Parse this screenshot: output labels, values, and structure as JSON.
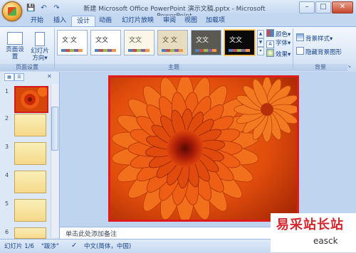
{
  "window": {
    "title": "新建 Microsoft Office PowerPoint 演示文稿.pptx - Microsoft PowerPoint",
    "minimize": "–",
    "maximize": "□",
    "close": "✕"
  },
  "quick_access": {
    "save": "💾",
    "undo": "↶",
    "redo": "↷"
  },
  "tabs": [
    {
      "label": "开始"
    },
    {
      "label": "插入"
    },
    {
      "label": "设计",
      "active": true
    },
    {
      "label": "动画"
    },
    {
      "label": "幻灯片放映"
    },
    {
      "label": "审阅"
    },
    {
      "label": "视图"
    },
    {
      "label": "加载项"
    }
  ],
  "ribbon": {
    "page_setup": {
      "button1": "页面设置",
      "button2_line1": "幻灯片",
      "button2_line2": "方向▾",
      "group": "页面设置"
    },
    "themes": {
      "group": "主题",
      "items": [
        {
          "text": "文 文",
          "bg": "#ffffff",
          "fg": "#333333"
        },
        {
          "text": "文文",
          "bg": "#ffffff",
          "fg": "#333333"
        },
        {
          "text": "文文",
          "bg": "#fbf6e8",
          "fg": "#555555"
        },
        {
          "text": "文 文",
          "bg": "#e8dcc0",
          "fg": "#5a4a2a"
        },
        {
          "text": "文文",
          "bg": "#5a5a50",
          "fg": "#ffffff"
        },
        {
          "text": "文文",
          "bg": "#0a0a0a",
          "fg": "#ffffff"
        }
      ]
    },
    "theme_options": {
      "colors": "颜色▾",
      "fonts": "字体▾",
      "effects": "效果▾"
    },
    "background": {
      "styles": "背景样式▾",
      "hide": "隐藏背景图形",
      "group": "背景"
    }
  },
  "slides_panel": {
    "numbers": [
      "1",
      "2",
      "3",
      "4",
      "5",
      "6"
    ]
  },
  "notes": {
    "placeholder": "单击此处添加备注"
  },
  "status": {
    "slide": "幻灯片 1/6",
    "theme": "\"跋涉\"",
    "language": "中文(简体，中国)"
  },
  "watermark": {
    "line1": "易采站长站",
    "line2": "easck"
  },
  "colors": {
    "slide_border": "#e01b1b",
    "ribbon": "#dbe7f7"
  }
}
